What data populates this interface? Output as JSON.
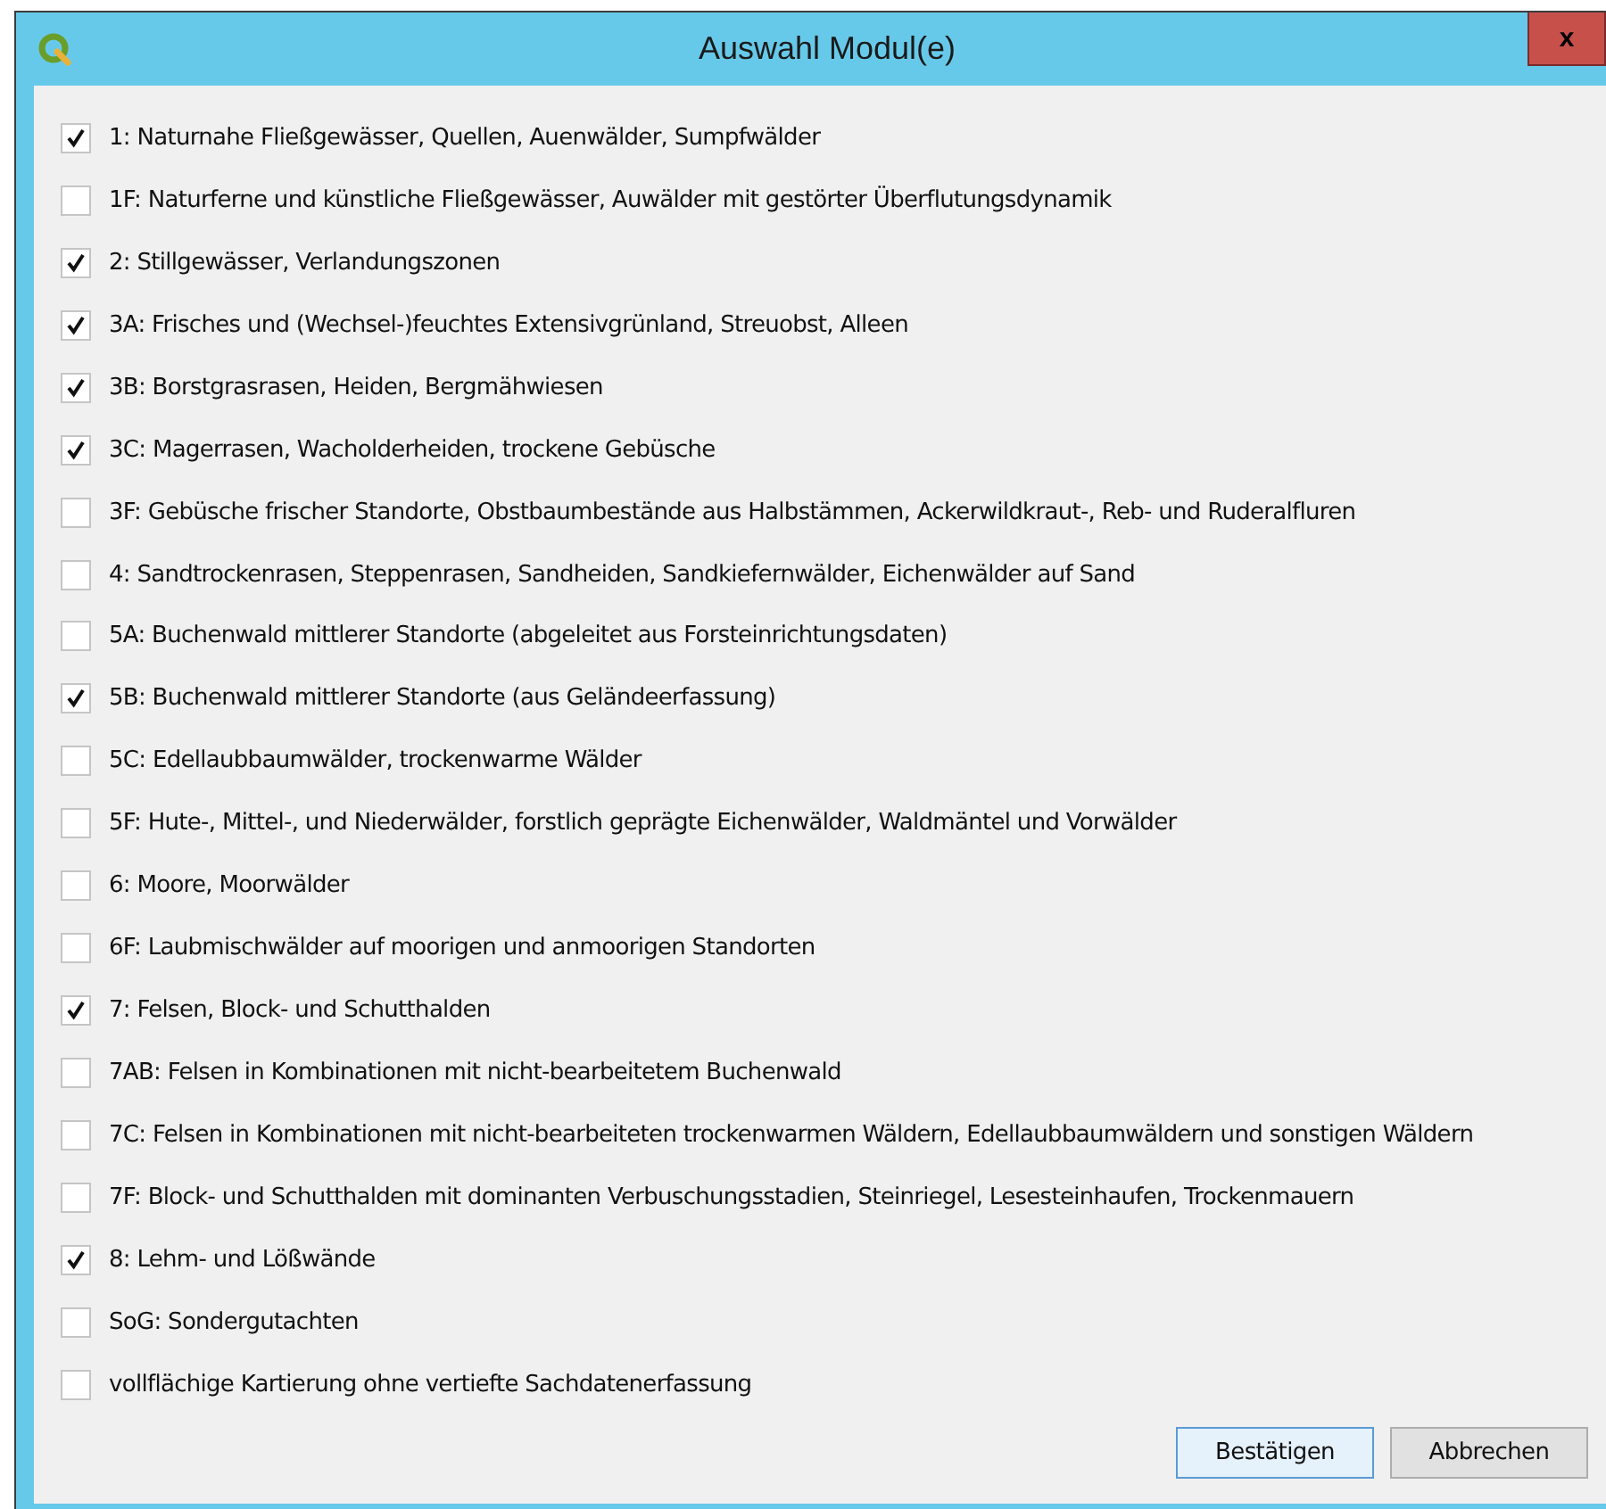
{
  "window": {
    "title": "Auswahl Modul(e)",
    "close": "x"
  },
  "modules": [
    {
      "label": "1: Naturnahe Fließgewässer, Quellen, Auenwälder, Sumpfwälder",
      "checked": true
    },
    {
      "label": "1F: Naturferne und künstliche Fließgewässer, Auwälder mit gestörter Überflutungsdynamik",
      "checked": false
    },
    {
      "label": "2: Stillgewässer, Verlandungszonen",
      "checked": true
    },
    {
      "label": "3A: Frisches und (Wechsel-)feuchtes Extensivgrünland, Streuobst, Alleen",
      "checked": true
    },
    {
      "label": "3B: Borstgrasrasen, Heiden, Bergmähwiesen",
      "checked": true
    },
    {
      "label": "3C: Magerrasen, Wacholderheiden, trockene Gebüsche",
      "checked": true
    },
    {
      "label": "3F: Gebüsche frischer Standorte, Obstbaumbestände aus Halbstämmen, Ackerwildkraut-, Reb- und Ruderalfluren",
      "checked": false
    },
    {
      "label": "4: Sandtrockenrasen, Steppenrasen, Sandheiden, Sandkiefernwälder, Eichenwälder auf Sand",
      "checked": false
    },
    {
      "label": "5A: Buchenwald mittlerer Standorte (abgeleitet aus Forsteinrichtungsdaten)",
      "checked": false
    },
    {
      "label": "5B: Buchenwald mittlerer Standorte (aus Geländeerfassung)",
      "checked": true
    },
    {
      "label": "5C: Edellaubbaumwälder, trockenwarme Wälder",
      "checked": false
    },
    {
      "label": "5F: Hute-, Mittel-, und Niederwälder, forstlich geprägte Eichenwälder, Waldmäntel und Vorwälder",
      "checked": false
    },
    {
      "label": "6: Moore, Moorwälder",
      "checked": false
    },
    {
      "label": "6F: Laubmischwälder auf moorigen und anmoorigen Standorten",
      "checked": false
    },
    {
      "label": "7: Felsen, Block- und Schutthalden",
      "checked": true
    },
    {
      "label": "7AB: Felsen in Kombinationen mit nicht-bearbeitetem Buchenwald",
      "checked": false
    },
    {
      "label": "7C: Felsen in Kombinationen mit nicht-bearbeiteten trockenwarmen Wäldern, Edellaubbaumwäldern und sonstigen Wäldern",
      "checked": false
    },
    {
      "label": "7F: Block- und Schutthalden mit dominanten Verbuschungsstadien, Steinriegel, Lesesteinhaufen, Trockenmauern",
      "checked": false
    },
    {
      "label": "8: Lehm- und Lößwände",
      "checked": true
    },
    {
      "label": "SoG: Sondergutachten",
      "checked": false
    },
    {
      "label": "vollflächige Kartierung ohne vertiefte Sachdatenerfassung",
      "checked": false
    }
  ],
  "buttons": [
    {
      "label": "Bestätigen",
      "kind": "default"
    },
    {
      "label": "Abbrechen",
      "kind": "normal"
    }
  ]
}
